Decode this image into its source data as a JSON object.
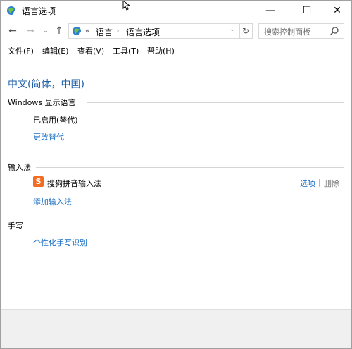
{
  "window": {
    "title": "语言选项",
    "minimize_glyph": "—",
    "maximize_glyph": "☐",
    "close_glyph": "✕"
  },
  "nav": {
    "back_glyph": "←",
    "forward_glyph": "→",
    "recent_glyph": "⌄",
    "up_glyph": "↑",
    "breadcrumb_prefix": "«",
    "breadcrumb": [
      "语言",
      "语言选项"
    ],
    "breadcrumb_separator": "›",
    "dropdown_glyph": "⌄",
    "refresh_glyph": "↻",
    "search_placeholder": "搜索控制面板"
  },
  "menu": {
    "items": [
      "文件(F)",
      "编辑(E)",
      "查看(V)",
      "工具(T)",
      "帮助(H)"
    ]
  },
  "content": {
    "page_title": "中文(简体，中国)",
    "display_language": {
      "heading": "Windows 显示语言",
      "status": "已启用(替代)",
      "change_link": "更改替代"
    },
    "input_method": {
      "heading": "输入法",
      "ime_icon_letter": "S",
      "ime_name": "搜狗拼音输入法",
      "options_link": "选项",
      "pipe": "|",
      "remove_link": "删除",
      "add_link": "添加输入法"
    },
    "handwriting": {
      "heading": "手写",
      "personalize_link": "个性化手写识别"
    }
  },
  "colors": {
    "title_blue": "#1e5fa8",
    "link_blue": "#1a6fc4",
    "ime_orange": "#f26c22"
  }
}
